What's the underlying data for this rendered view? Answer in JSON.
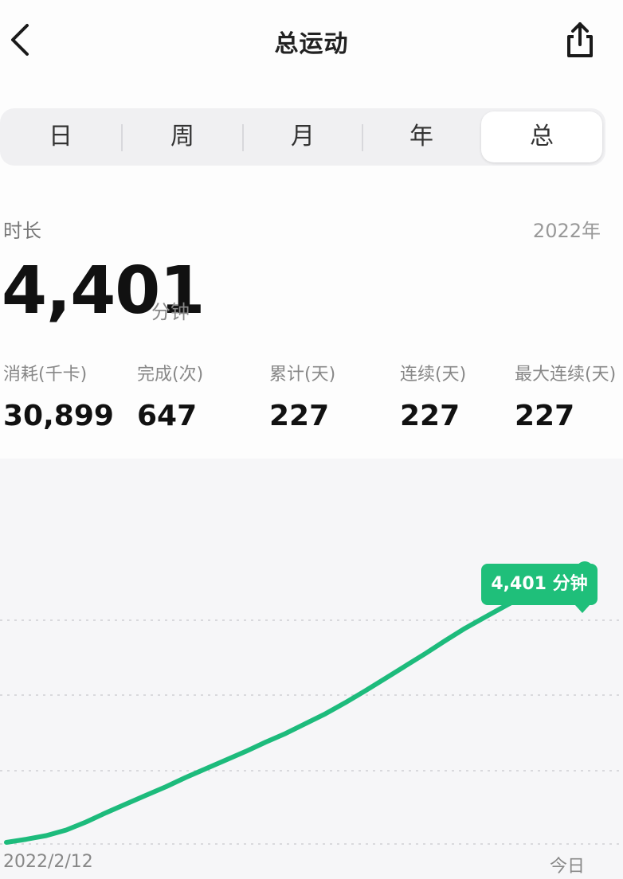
{
  "header": {
    "title": "总运动"
  },
  "tabs": [
    {
      "label": "日",
      "active": false
    },
    {
      "label": "周",
      "active": false
    },
    {
      "label": "月",
      "active": false
    },
    {
      "label": "年",
      "active": false
    },
    {
      "label": "总",
      "active": true
    }
  ],
  "summary": {
    "label": "时长",
    "year": "2022年",
    "value": "4,401",
    "unit": "分钟"
  },
  "stats": [
    {
      "label": "消耗(千卡)",
      "value": "30,899"
    },
    {
      "label": "完成(次)",
      "value": "647"
    },
    {
      "label": "累计(天)",
      "value": "227"
    },
    {
      "label": "连续(天)",
      "value": "227"
    },
    {
      "label": "最大连续(天)",
      "value": "227"
    }
  ],
  "colors": {
    "accent": "#1fbf7a",
    "line": "#1dbb7c"
  },
  "icons": {
    "back": "chevron-left-icon",
    "share": "share-icon"
  },
  "chart_data": {
    "type": "line",
    "tooltip": "4,401 分钟",
    "x_start_label": "2022/2/12",
    "x_end_label": "今日",
    "ylim": [
      0,
      4800
    ],
    "gridlines": 3,
    "series": [
      {
        "values": [
          0,
          50,
          110,
          200,
          330,
          480,
          620,
          760,
          900,
          1050,
          1190,
          1330,
          1470,
          1620,
          1760,
          1920,
          2080,
          2260,
          2450,
          2650,
          2850,
          3050,
          3260,
          3460,
          3640,
          3820,
          3990,
          4130,
          4260,
          4401
        ]
      }
    ]
  }
}
